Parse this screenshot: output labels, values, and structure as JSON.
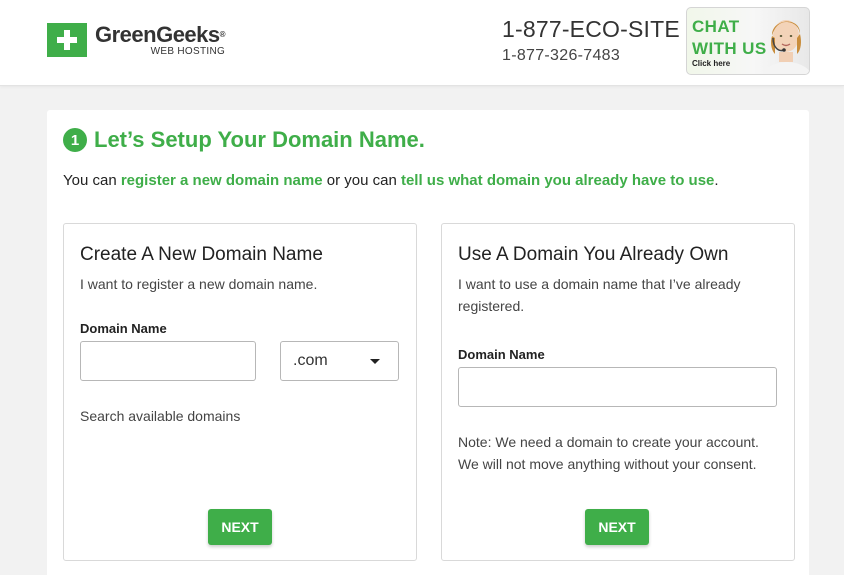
{
  "header": {
    "logo": {
      "name": "GreenGeeks",
      "registered": "®",
      "subtitle": "WEB HOSTING"
    },
    "phone_vanity": "1-877-ECO-SITE",
    "phone_number": "1-877-326-7483",
    "chat": {
      "line1": "CHAT",
      "line2": "WITH US",
      "cta": "Click here"
    }
  },
  "setup": {
    "step": "1",
    "title": "Let’s Setup Your Domain Name.",
    "intro": {
      "prefix": "You can ",
      "link_register": "register a new domain name",
      "middle": " or you can ",
      "link_existing": "tell us what domain you already have to use",
      "suffix": "."
    }
  },
  "new_domain": {
    "title": "Create A New Domain Name",
    "description": "I want to register a new domain name.",
    "field_label": "Domain Name",
    "input_value": "",
    "tld_selected": ".com",
    "search_link": "Search available domains",
    "next_label": "NEXT"
  },
  "existing_domain": {
    "title": "Use A Domain You Already Own",
    "description": "I want to use a domain name that I’ve already registered.",
    "field_label": "Domain Name",
    "input_value": "",
    "note_line1": "Note: We need a domain to create your account.",
    "note_line2": "We will not move anything without your consent.",
    "next_label": "NEXT"
  },
  "colors": {
    "brand_green": "#3fae49",
    "page_bg": "#f2f2f2",
    "border": "#d9d9d9"
  },
  "icons": [
    "greengeeks-plus-logo-icon",
    "chevron-down-icon",
    "chat-agent-icon"
  ]
}
